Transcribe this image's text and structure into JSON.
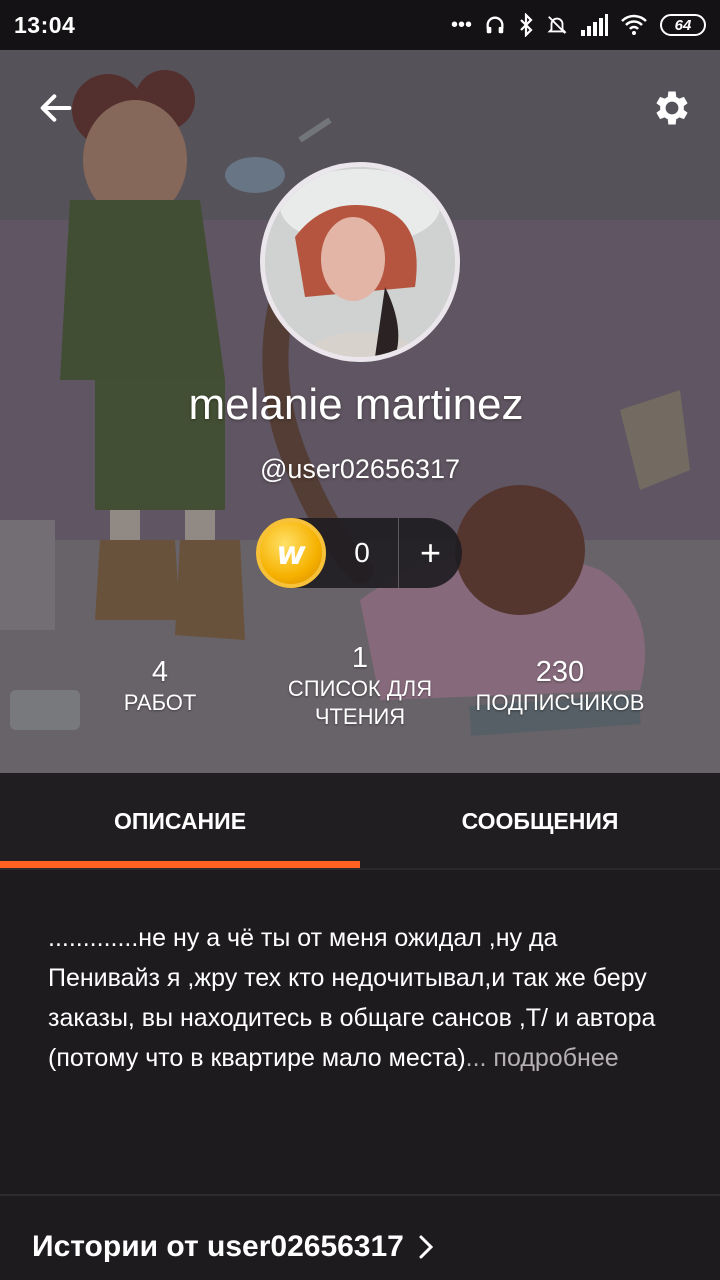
{
  "status_bar": {
    "time": "13:04",
    "battery": "64"
  },
  "profile": {
    "name": "melanie martinez",
    "handle": "@user02656317",
    "coins": "0",
    "coin_add_label": "+"
  },
  "stats": [
    {
      "value": "4",
      "label": "РАБОТ"
    },
    {
      "value": "1",
      "label": "СПИСОК ДЛЯ ЧТЕНИЯ"
    },
    {
      "value": "230",
      "label": "ПОДПИСЧИКОВ"
    }
  ],
  "tabs": [
    {
      "label": "ОПИСАНИЕ",
      "active": true
    },
    {
      "label": "СООБЩЕНИЯ",
      "active": false
    }
  ],
  "description": {
    "text": ".............не ну а чё ты от меня ожидал ,ну да Пенивайз я ,жру тех кто недочитывал,и так же беру заказы, вы находитесь в общаге сансов ,Т/ и автора (потому что в квартире мало места)",
    "more": "... подробнее"
  },
  "stories": {
    "title": "Истории от user02656317"
  },
  "colors": {
    "accent": "#ff6122",
    "background": "#1e1b1f",
    "coin": "#f6b100"
  },
  "icons": {
    "back": "arrow-left-icon",
    "settings": "gear-icon",
    "coin": "wattpad-coin-icon",
    "stories_chevron": "chevron-right-icon"
  }
}
